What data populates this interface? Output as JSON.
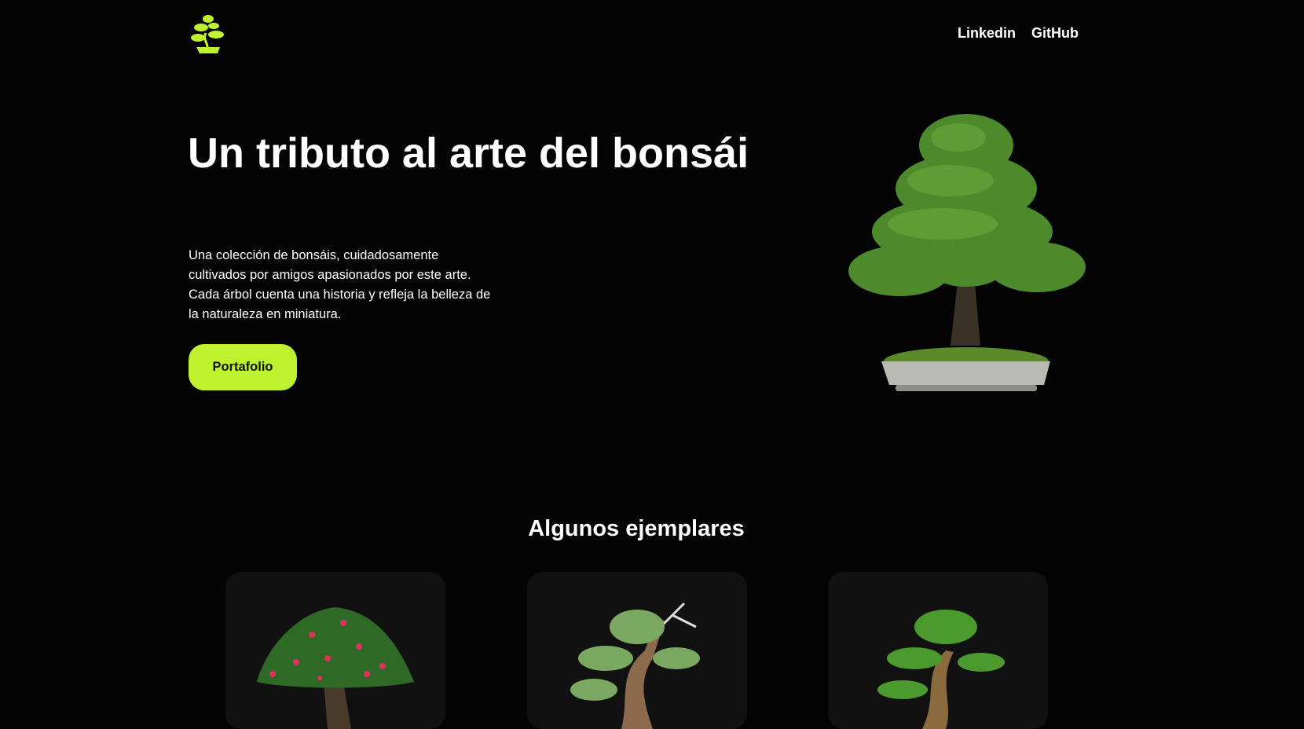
{
  "header": {
    "logo": "bonsai-logo",
    "nav": [
      {
        "label": "Linkedin"
      },
      {
        "label": "GitHub"
      }
    ]
  },
  "hero": {
    "title": "Un tributo al arte del bonsái",
    "description": "Una colección de bonsáis, cuidadosamente cultivados por amigos apasionados por este arte. Cada árbol cuenta una historia y refleja la belleza de la naturaleza en miniatura.",
    "button": "Portafolio"
  },
  "gallery": {
    "title": "Algunos ejemplares"
  },
  "colors": {
    "accent": "#bff22e",
    "background": "#040404",
    "card": "#111111"
  }
}
